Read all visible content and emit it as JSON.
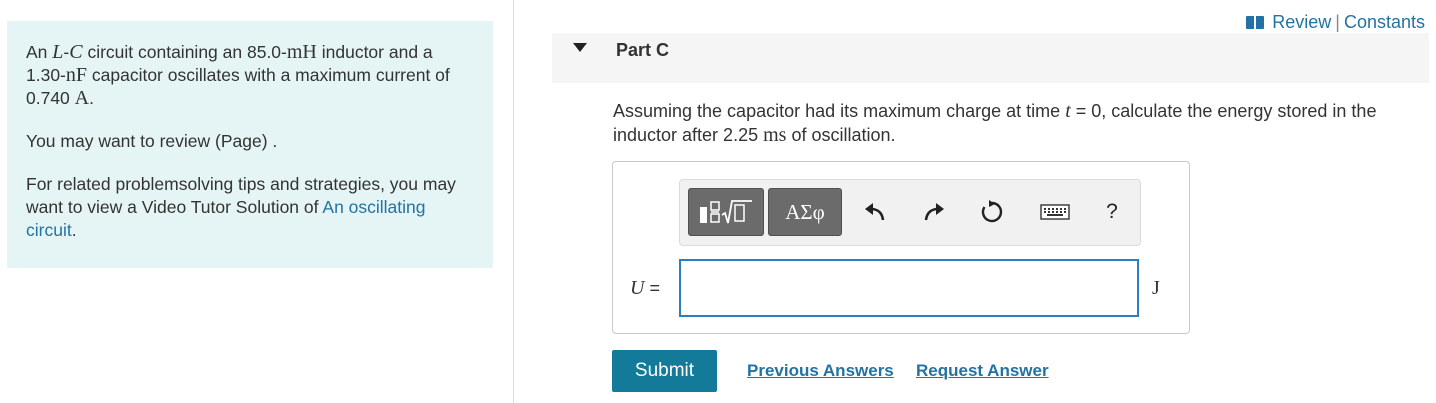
{
  "problem": {
    "intro_pre": "An ",
    "intro_L": "L",
    "intro_dash": "-",
    "intro_C": "C",
    "intro_mid": " circuit containing an 85.0-",
    "intro_mH": "mH",
    "intro_mid2": " inductor and a 1.30-",
    "intro_nF": "nF",
    "intro_mid3": " capacitor oscillates with a maximum current of 0.740 ",
    "intro_A": "A",
    "intro_end": ".",
    "review_text": "You may want to review (Page) .",
    "tips_pre": "For related problemsolving tips and strategies, you may want to view a Video Tutor Solution of ",
    "tips_link": "An oscillating circuit",
    "tips_end": "."
  },
  "header": {
    "review_label": "Review",
    "separator": "|",
    "constants_label": "Constants"
  },
  "part": {
    "title": "Part C",
    "question_pre": "Assuming the capacitor had its maximum charge at time ",
    "question_t": "t",
    "question_mid": " = 0, calculate the energy stored in the inductor after 2.25 ",
    "question_ms": "ms",
    "question_end": " of oscillation."
  },
  "toolbar": {
    "greek_label": "ΑΣφ",
    "help_label": "?"
  },
  "answer": {
    "variable": "U",
    "equals": "=",
    "value": "",
    "unit": "J"
  },
  "actions": {
    "submit_label": "Submit",
    "previous_answers_label": "Previous Answers",
    "request_answer_label": "Request Answer"
  },
  "colors": {
    "panel_bg": "#e5f5f6",
    "link": "#2273a3",
    "submit_bg": "#137a9a",
    "input_border": "#2a7fc1"
  },
  "icons": [
    "book-icon",
    "collapse-triangle-icon",
    "template-icon",
    "undo-icon",
    "redo-icon",
    "reset-icon",
    "keyboard-icon",
    "help-icon"
  ]
}
